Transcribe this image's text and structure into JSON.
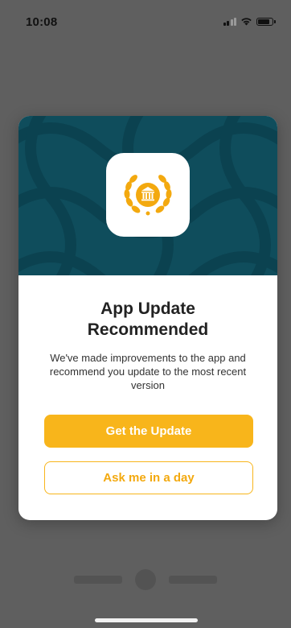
{
  "status_bar": {
    "time": "10:08",
    "battery_level": 0.85
  },
  "modal": {
    "header_color": "#0f4d5c",
    "app_icon": "laurel-bank-logo-icon",
    "title": "App Update Recommended",
    "message": "We've made improvements to the app and recommend you update to the most recent version",
    "primary_button": "Get the Update",
    "secondary_button": "Ask me in a day",
    "accent_color": "#f8b51b"
  }
}
